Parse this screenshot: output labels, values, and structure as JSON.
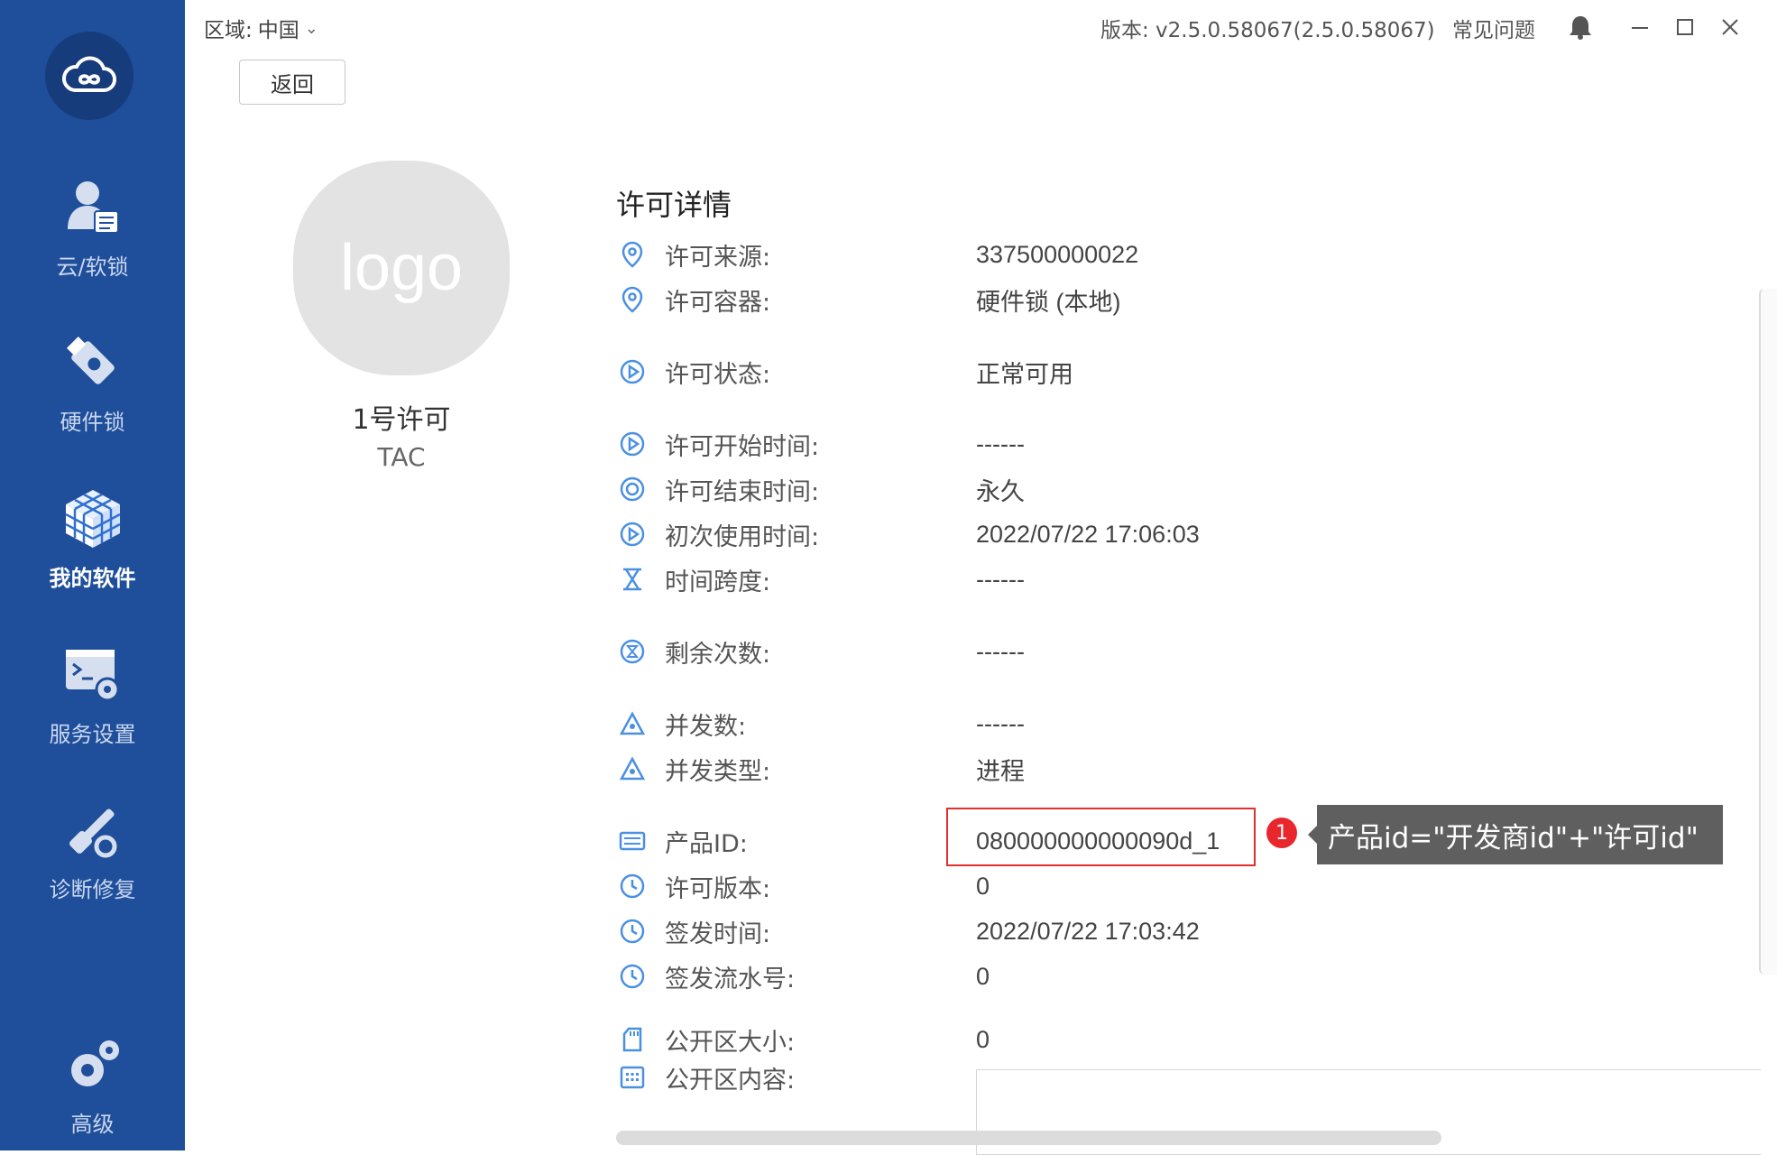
{
  "sidebar": {
    "items": [
      {
        "label": "云/软锁",
        "icon": "cloud-user-icon"
      },
      {
        "label": "硬件锁",
        "icon": "usb-dongle-icon"
      },
      {
        "label": "我的软件",
        "icon": "cubes-icon",
        "active": true
      },
      {
        "label": "服务设置",
        "icon": "terminal-gear-icon"
      },
      {
        "label": "诊断修复",
        "icon": "wrench-repair-icon"
      },
      {
        "label": "高级",
        "icon": "gears-icon"
      }
    ]
  },
  "topbar": {
    "region_label": "区域:",
    "region_value": "中国",
    "version": "版本: v2.5.0.58067(2.5.0.58067)",
    "faq": "常见问题"
  },
  "back_button": "返回",
  "license_card": {
    "logo_text": "logo",
    "name": "1号许可",
    "code": "TAC"
  },
  "details": {
    "title": "许可详情",
    "rows": [
      {
        "label": "许可来源:",
        "value": "337500000022",
        "icon": "location-pin-icon"
      },
      {
        "label": "许可容器:",
        "value": "硬件锁 (本地)",
        "icon": "location-pin-icon"
      },
      {
        "label": "许可状态:",
        "value": "正常可用",
        "icon": "play-circle-icon"
      },
      {
        "label": "许可开始时间:",
        "value": "------",
        "icon": "play-circle-icon"
      },
      {
        "label": "许可结束时间:",
        "value": "永久",
        "icon": "clock-circle-icon"
      },
      {
        "label": "初次使用时间:",
        "value": "2022/07/22 17:06:03",
        "icon": "play-circle-icon"
      },
      {
        "label": "时间跨度:",
        "value": "------",
        "icon": "hourglass-icon"
      },
      {
        "label": "剩余次数:",
        "value": "------",
        "icon": "hourglass-circle-icon"
      },
      {
        "label": "并发数:",
        "value": "------",
        "icon": "network-triangle-icon"
      },
      {
        "label": "并发类型:",
        "value": "进程",
        "icon": "network-triangle-icon"
      },
      {
        "label": "产品ID:",
        "value": "080000000000090d_1",
        "icon": "keyboard-icon"
      },
      {
        "label": "许可版本:",
        "value": "0",
        "icon": "clock-icon"
      },
      {
        "label": "签发时间:",
        "value": "2022/07/22 17:03:42",
        "icon": "clock-icon"
      },
      {
        "label": "签发流水号:",
        "value": "0",
        "icon": "clock-icon"
      },
      {
        "label": "公开区大小:",
        "value": "0",
        "icon": "sd-card-icon"
      },
      {
        "label": "公开区内容:",
        "value": "",
        "icon": "grid-box-icon"
      }
    ]
  },
  "annotation": {
    "badge": "1",
    "callout": "产品id=\"开发商id\"+\"许可id\"",
    "highlight_color": "#e0302f"
  },
  "colors": {
    "sidebar": "#1f4f9b",
    "icon_accent": "#4a90e2"
  }
}
